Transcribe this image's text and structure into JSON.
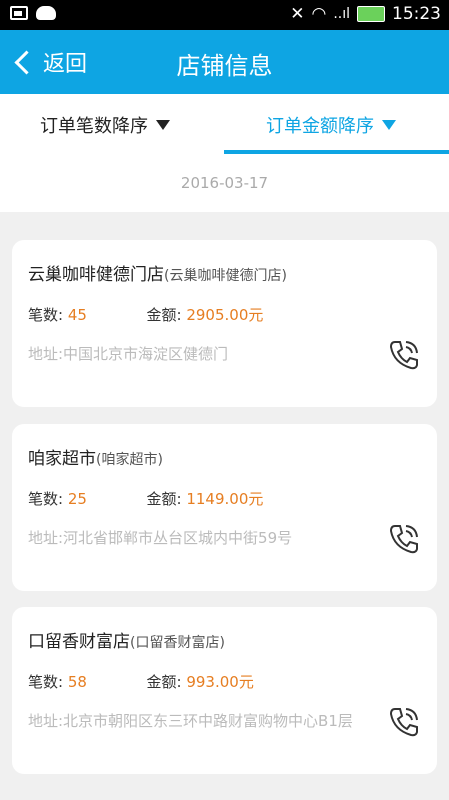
{
  "status_bar": {
    "time": "15:23",
    "signal": "..ıl"
  },
  "header": {
    "back_label": "返回",
    "title": "店铺信息"
  },
  "tabs": [
    {
      "label": "订单笔数降序",
      "active": false
    },
    {
      "label": "订单金额降序",
      "active": true
    }
  ],
  "date": "2016-03-17",
  "colors": {
    "accent": "#0ea5e3",
    "value": "#e67e22"
  },
  "stores": [
    {
      "name": "云巢咖啡健德门店",
      "sub": "(云巢咖啡健德门店)",
      "count_label": "笔数:",
      "count": "45",
      "amount_label": "金额:",
      "amount": "2905.00元",
      "address": "地址:中国北京市海淀区健德门"
    },
    {
      "name": "咱家超市",
      "sub": "(咱家超市)",
      "count_label": "笔数:",
      "count": "25",
      "amount_label": "金额:",
      "amount": "1149.00元",
      "address": "地址:河北省邯郸市丛台区城内中街59号"
    },
    {
      "name": "口留香财富店",
      "sub": "(口留香财富店)",
      "count_label": "笔数:",
      "count": "58",
      "amount_label": "金额:",
      "amount": "993.00元",
      "address": "地址:北京市朝阳区东三环中路财富购物中心B1层"
    }
  ]
}
